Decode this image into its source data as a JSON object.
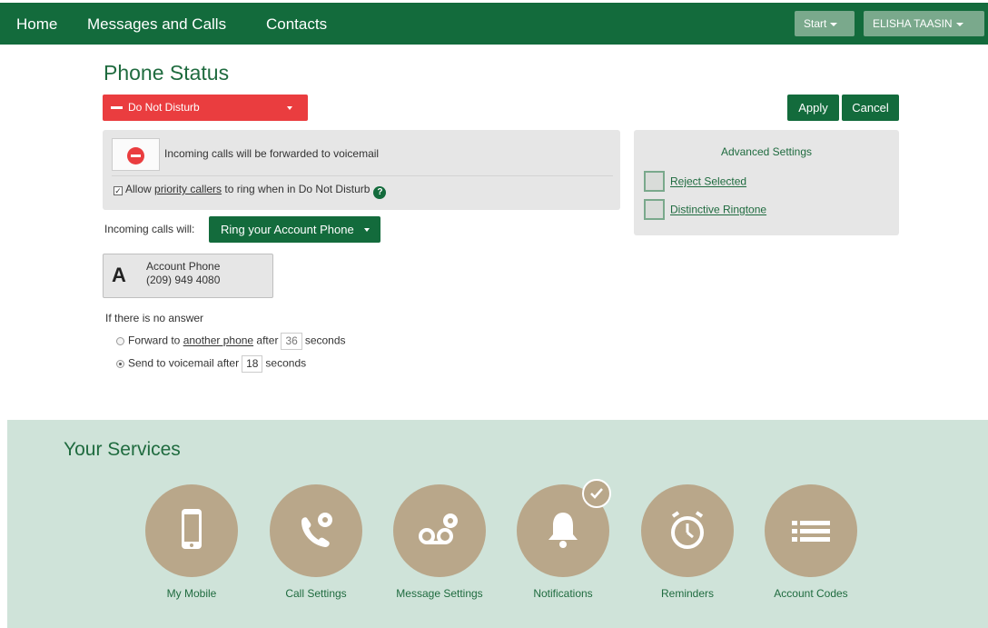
{
  "nav": {
    "home": "Home",
    "messages_calls": "Messages and Calls",
    "contacts": "Contacts",
    "start": "Start",
    "user": "ELISHA TAASIN"
  },
  "phone_status": {
    "title": "Phone Status",
    "status": "Do Not Disturb",
    "apply": "Apply",
    "cancel": "Cancel",
    "dnd_message": "Incoming calls will be forwarded to voicemail",
    "priority_prefix": "Allow ",
    "priority_link": "priority callers",
    "priority_suffix": " to ring when in Do Not Disturb",
    "priority_checked": true,
    "help": "?"
  },
  "advanced": {
    "title": "Advanced Settings",
    "items": [
      {
        "label": "Reject Selected"
      },
      {
        "label": "Distinctive Ringtone"
      }
    ]
  },
  "incoming": {
    "label": "Incoming calls will:",
    "selected": "Ring your Account Phone"
  },
  "account_phone": {
    "letter": "A",
    "name": "Account Phone",
    "number": "(209) 949 4080"
  },
  "no_answer": {
    "heading": "If there is no answer",
    "forward_prefix": "Forward to ",
    "forward_link": "another phone",
    "forward_after": " after",
    "forward_seconds": "36",
    "forward_unit": "seconds",
    "voicemail_prefix": "Send to voicemail after",
    "voicemail_seconds": "18",
    "voicemail_unit": "seconds",
    "selected": "voicemail"
  },
  "services": {
    "title": "Your Services",
    "items": [
      {
        "label": "My Mobile",
        "icon": "mobile-phone-icon"
      },
      {
        "label": "Call Settings",
        "icon": "phone-gear-icon"
      },
      {
        "label": "Message Settings",
        "icon": "voicemail-gear-icon"
      },
      {
        "label": "Notifications",
        "icon": "bell-icon",
        "checked": true
      },
      {
        "label": "Reminders",
        "icon": "alarm-clock-icon"
      },
      {
        "label": "Account Codes",
        "icon": "list-icon"
      }
    ]
  },
  "colors": {
    "brand_green": "#136b3c",
    "dnd_red": "#ea3d3f",
    "services_bg": "#cfe3d9",
    "service_circle": "#b9a78a"
  }
}
